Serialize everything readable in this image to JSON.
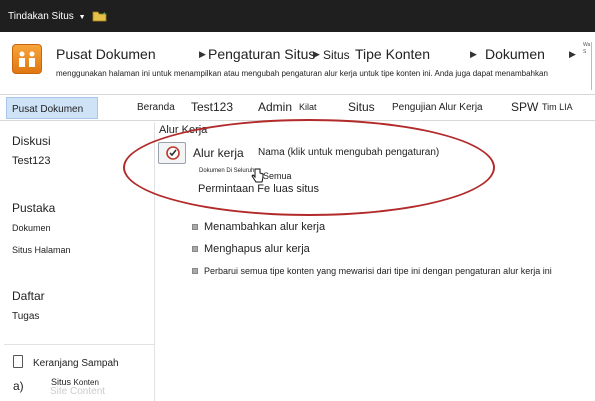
{
  "topbar": {
    "site_actions": "Tindakan Situs",
    "caret": "▼",
    "folder_icon": "folder-icon"
  },
  "title_area": {
    "breadcrumb": [
      "Pusat Dokumen",
      "Pengaturan Situs",
      "Situs",
      "Tipe Konten",
      "Dokumen"
    ],
    "separator": "▶",
    "description": "menggunakan halaman ini untuk menampilkan atau mengubah pengaturan alur kerja untuk tipe konten ini. Anda juga dapat menambahkan",
    "right_mini": "Wa\nS"
  },
  "nav": {
    "items": [
      "Pusat Dokumen",
      "Beranda",
      "Test123",
      "Admin",
      "Kilat",
      "Situs",
      "Pengujian Alur Kerja",
      "SPW",
      "Tim LIA"
    ]
  },
  "left_nav": {
    "diskusi": "Diskusi",
    "test123": "Test123",
    "pustaka": "Pustaka",
    "dokumen": "Dokumen",
    "situs": "Situs",
    "halaman": "Halaman",
    "daftar": "Daftar",
    "tugas": "Tugas",
    "recycle_bin": "Keranjang Sampah",
    "footer_a": "a)",
    "site_content_label": "Situs",
    "site_content_value": "Konten",
    "site_content_ghost": "Site Content"
  },
  "main": {
    "section_title": "Alur Kerja",
    "workflow_label": "Alur kerja",
    "name_hint": "Nama (klik untuk mengubah pengaturan)",
    "doc_item": "Dokumen Di Seluruh",
    "semua": "Semua",
    "approval": "Permintaan Fe luas situs",
    "links": [
      "Menambahkan alur kerja",
      "Menghapus alur kerja",
      "Perbarui semua tipe konten yang mewarisi dari tipe ini dengan pengaturan alur kerja ini"
    ],
    "cursor_icon": "hand-pointer-icon"
  },
  "colors": {
    "topbar": "#1f1f1f",
    "annotation_oval": "#b22a2a",
    "nav_selected": "#cfe3f7"
  }
}
